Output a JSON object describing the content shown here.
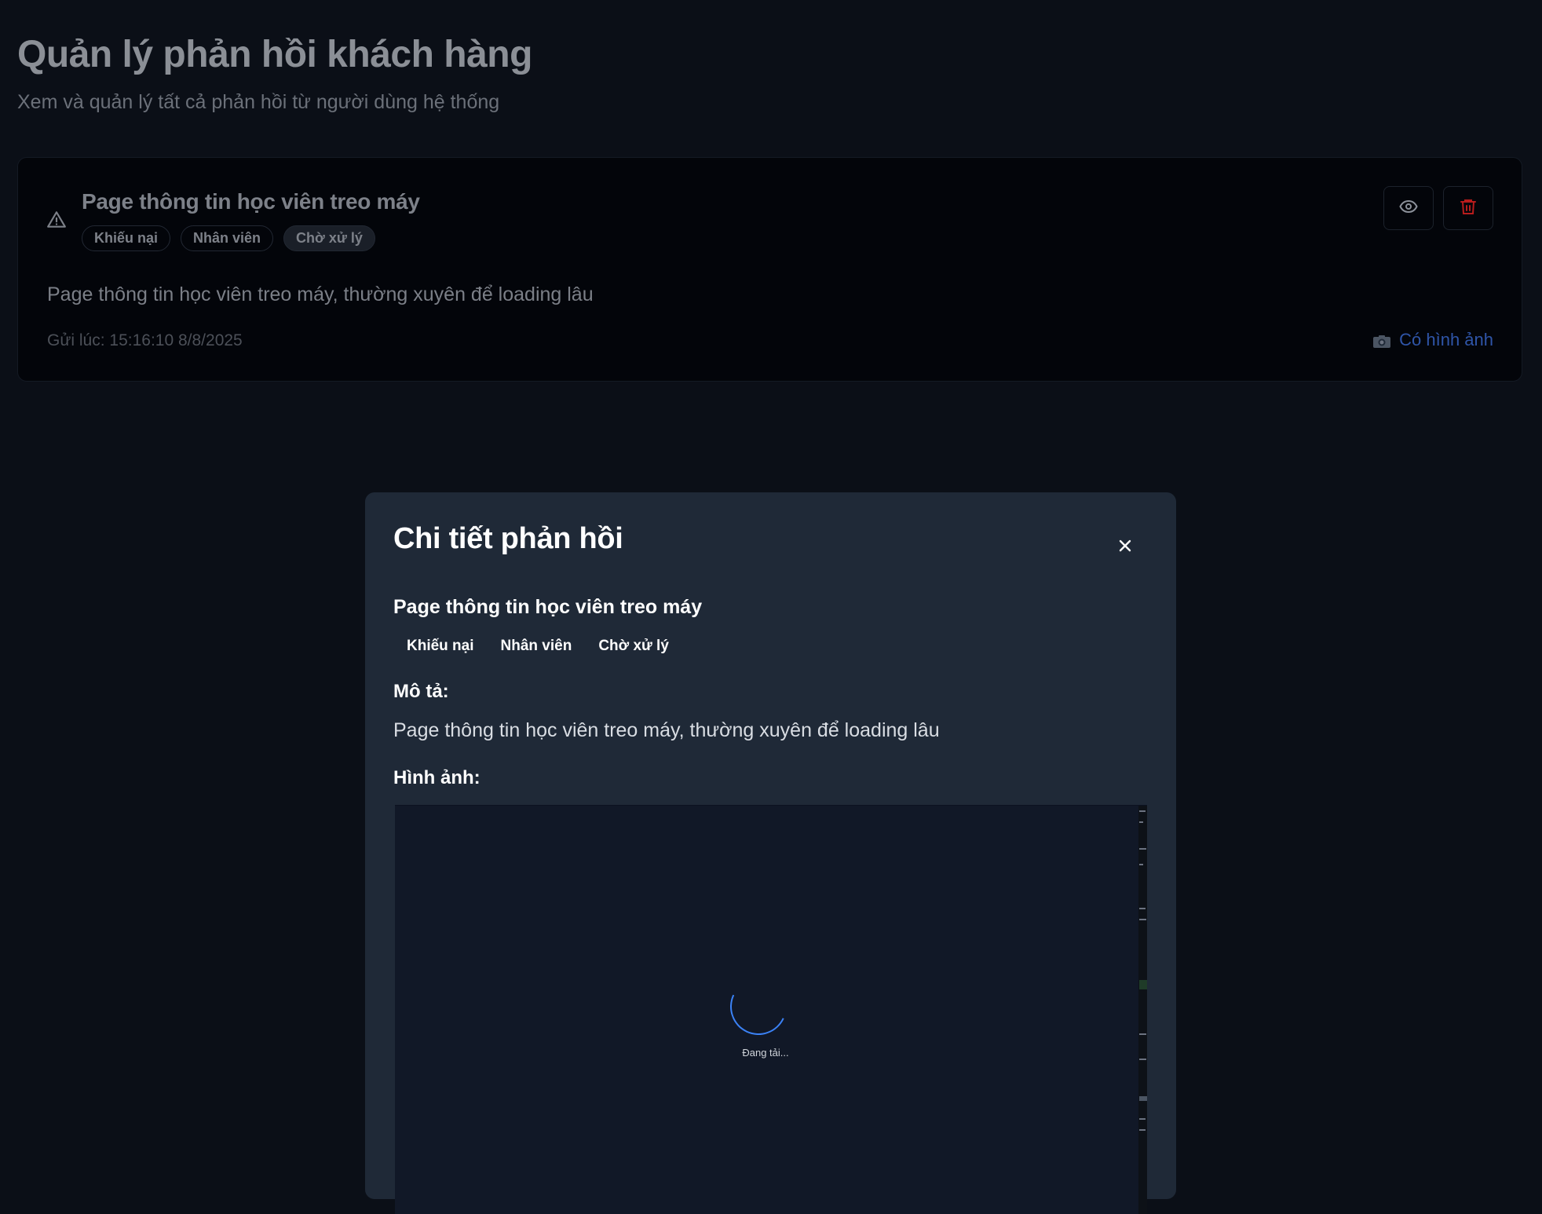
{
  "page": {
    "title": "Quản lý phản hồi khách hàng",
    "subtitle": "Xem và quản lý tất cả phản hồi từ người dùng hệ thống"
  },
  "card": {
    "icon": "warning-triangle-icon",
    "title": "Page thông tin học viên treo máy",
    "tags": [
      "Khiếu nại",
      "Nhân viên",
      "Chờ xử lý"
    ],
    "description": "Page thông tin học viên treo máy, thường xuyên để loading lâu",
    "sent_at": "Gửi lúc: 15:16:10 8/8/2025",
    "image_link": "Có hình ảnh",
    "colors": {
      "delete": "#b91c1c",
      "link": "#2f55a8"
    }
  },
  "modal": {
    "title": "Chi tiết phản hồi",
    "feedback_title": "Page thông tin học viên treo máy",
    "tags": [
      "Khiếu nại",
      "Nhân viên",
      "Chờ xử lý"
    ],
    "description_label": "Mô tả:",
    "description": "Page thông tin học viên treo máy, thường xuyên để loading lâu",
    "image_label": "Hình ảnh:",
    "loading_text": "Đang tải...",
    "colors": {
      "background": "#1f2937",
      "spinner": "#3b82f6"
    }
  }
}
